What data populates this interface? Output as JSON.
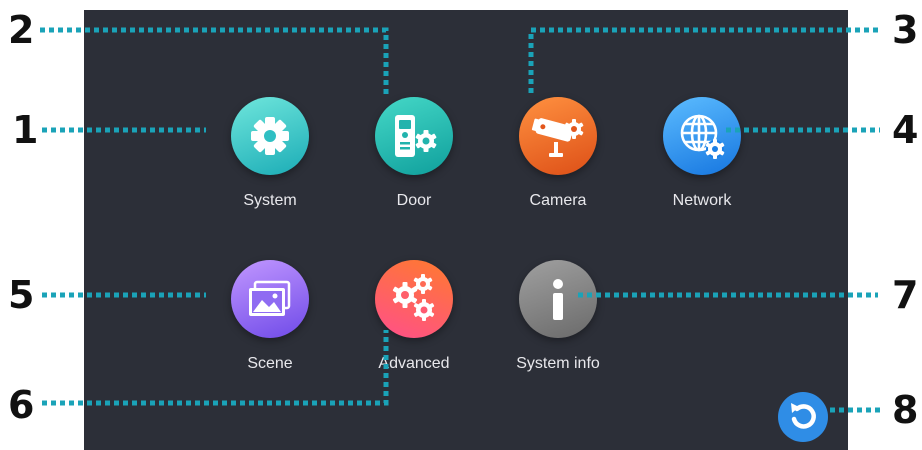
{
  "apps": [
    {
      "id": "system",
      "label": "System",
      "color_a": "#5fe0d6",
      "color_b": "#1fb2b8",
      "icon": "gear-icon"
    },
    {
      "id": "door",
      "label": "Door",
      "color_a": "#3cd3c2",
      "color_b": "#12a3a0",
      "icon": "door-phone-icon"
    },
    {
      "id": "camera",
      "label": "Camera",
      "color_a": "#ff8a3a",
      "color_b": "#e2561b",
      "icon": "cctv-camera-icon"
    },
    {
      "id": "network",
      "label": "Network",
      "color_a": "#4fb6ff",
      "color_b": "#1a7fe6",
      "icon": "globe-gear-icon"
    },
    {
      "id": "scene",
      "label": "Scene",
      "color_a": "#b48cff",
      "color_b": "#7a55f0",
      "icon": "picture-icon"
    },
    {
      "id": "advanced",
      "label": "Advanced",
      "color_a": "#ff5f85",
      "color_b": "#ff7a2e",
      "icon": "gears-icon"
    },
    {
      "id": "system-info",
      "label": "System info",
      "color_a": "#9a9a9a",
      "color_b": "#6f6f6f",
      "icon": "info-icon"
    }
  ],
  "reset": {
    "color": "#2f8de6",
    "icon": "refresh-icon"
  },
  "callouts": [
    "1",
    "2",
    "3",
    "4",
    "5",
    "6",
    "7",
    "8"
  ],
  "colors": {
    "background": "#2c2f38",
    "leader_line": "#1aa3b8",
    "label": "#e8e8ec"
  }
}
